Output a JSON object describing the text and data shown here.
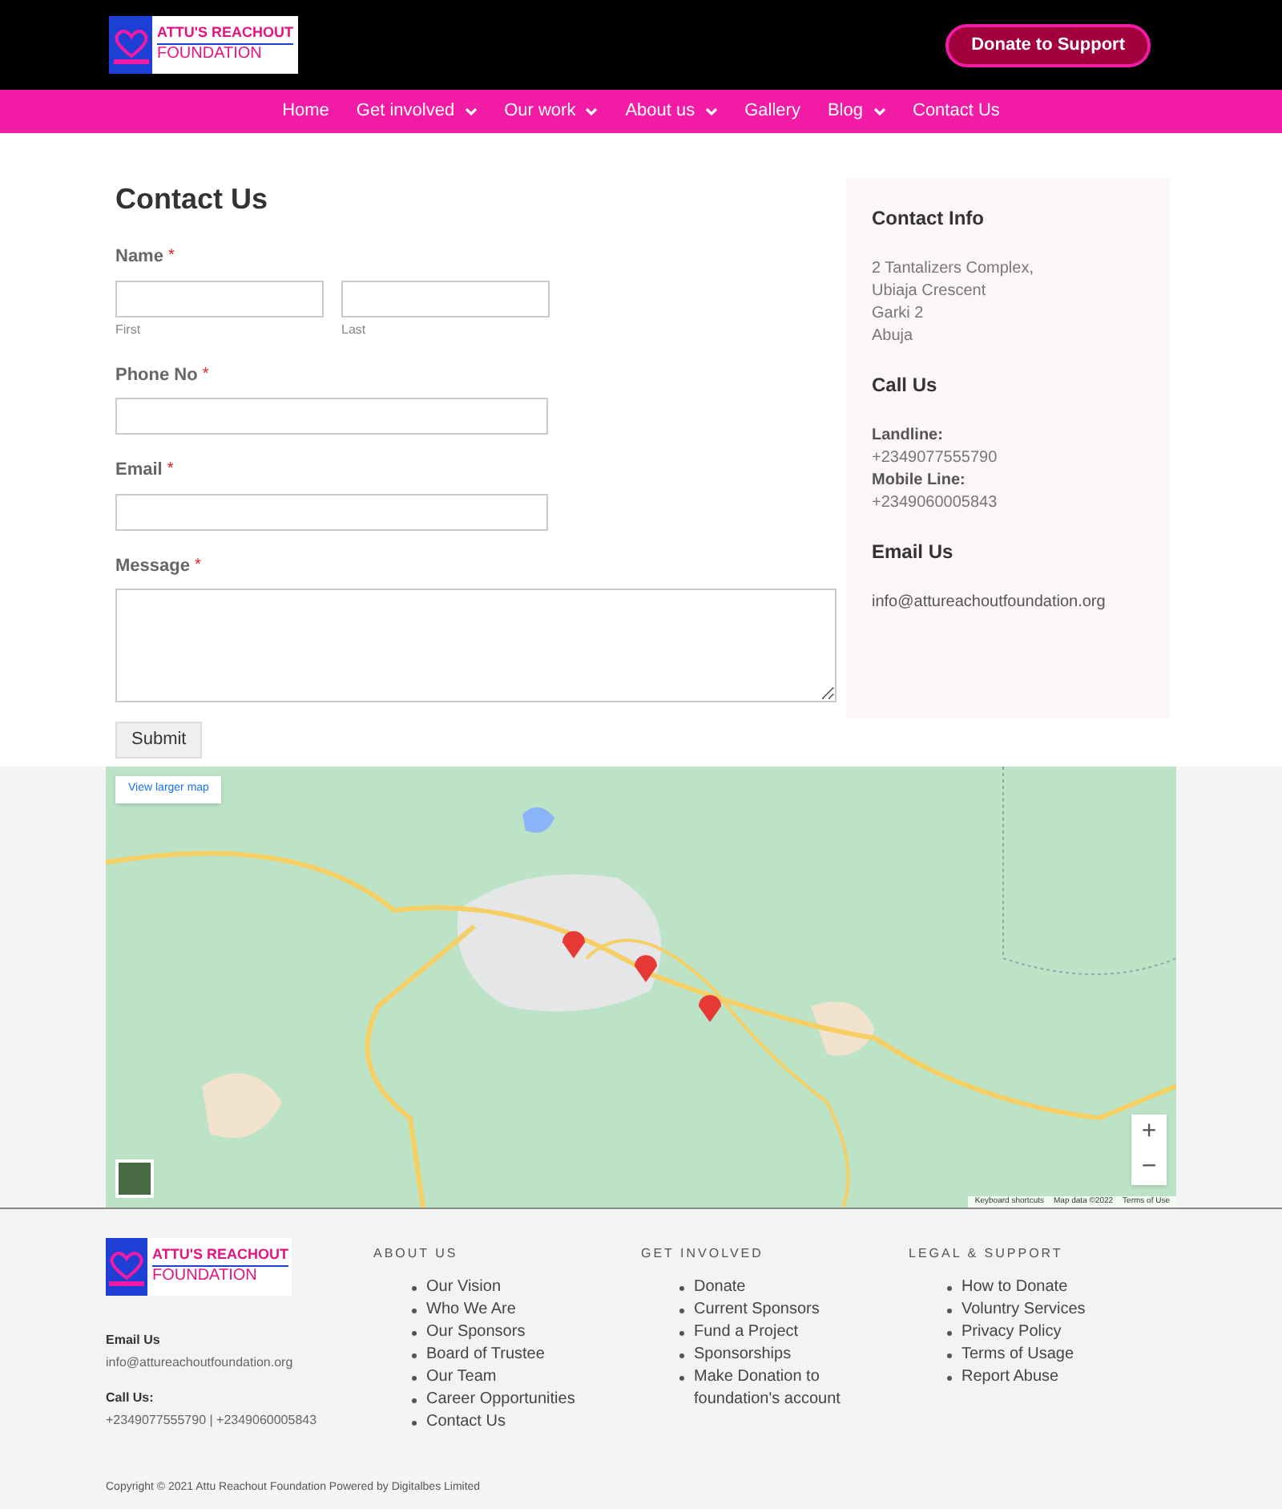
{
  "header": {
    "logo": {
      "line_1": "ATTU'S REACHOUT",
      "line_2": "FOUNDATION"
    },
    "donate_button": "Donate to Support"
  },
  "nav": [
    {
      "label": "Home",
      "has_menu": false
    },
    {
      "label": "Get involved",
      "has_menu": true
    },
    {
      "label": "Our work",
      "has_menu": true
    },
    {
      "label": "About us",
      "has_menu": true
    },
    {
      "label": "Gallery",
      "has_menu": false
    },
    {
      "label": "Blog",
      "has_menu": true
    },
    {
      "label": "Contact Us",
      "has_menu": false
    }
  ],
  "form": {
    "title": "Contact Us",
    "fields": [
      {
        "kind": "name",
        "label": "Name",
        "required_mark": "*",
        "sublabels": [
          "First",
          "Last"
        ]
      },
      {
        "kind": "text",
        "label": "Phone No",
        "required_mark": "*"
      },
      {
        "kind": "text",
        "label": "Email",
        "required_mark": "*"
      },
      {
        "kind": "textarea",
        "label": "Message",
        "required_mark": "*"
      }
    ],
    "submit": "Submit"
  },
  "contact_info": {
    "sections": [
      {
        "heading": "Contact Info",
        "lines": [
          {
            "kind": "text",
            "text": "2 Tantalizers Complex,"
          },
          {
            "kind": "text",
            "text": "Ubiaja Crescent"
          },
          {
            "kind": "text",
            "text": "Garki 2"
          },
          {
            "kind": "text",
            "text": "Abuja"
          }
        ]
      },
      {
        "heading": "Call Us",
        "lines": [
          {
            "kind": "label",
            "text": "Landline:"
          },
          {
            "kind": "text",
            "text": "+2349077555790"
          },
          {
            "kind": "label",
            "text": "Mobile Line:"
          },
          {
            "kind": "text",
            "text": "+2349060005843"
          }
        ]
      },
      {
        "heading": "Email Us",
        "lines": [
          {
            "kind": "link",
            "text": "info@attureachoutfoundation.org"
          }
        ]
      }
    ]
  },
  "map": {
    "kind": "picture",
    "larger_map_link": "View larger map",
    "zoom_in": "+",
    "zoom_out": "−",
    "attribution": [
      "Keyboard shortcuts",
      "Map data ©2022",
      "Terms of Use"
    ]
  },
  "footer": {
    "logo": {
      "line_1": "ATTU'S REACHOUT",
      "line_2": "FOUNDATION"
    },
    "email_label": "Email Us",
    "email": "info@attureachoutfoundation.org",
    "call_label": "Call Us:",
    "phones": "+2349077555790 | +2349060005843",
    "columns": [
      {
        "heading": "ABOUT US",
        "items": [
          "Our Vision",
          "Who We Are",
          "Our Sponsors",
          "Board of Trustee",
          "Our Team",
          "Career Opportunities",
          "Contact Us"
        ]
      },
      {
        "heading": "GET INVOLVED",
        "items": [
          "Donate",
          "Current Sponsors",
          "Fund a Project",
          "Sponsorships",
          "Make Donation to foundation's account"
        ]
      },
      {
        "heading": "LEGAL & SUPPORT",
        "items": [
          "How to Donate",
          "Voluntry Services",
          "Privacy Policy",
          "Terms of Usage",
          "Report Abuse"
        ]
      }
    ],
    "copyright": "Copyright © 2021 Attu Reachout Foundation Powered by Digitalbes Limited"
  }
}
